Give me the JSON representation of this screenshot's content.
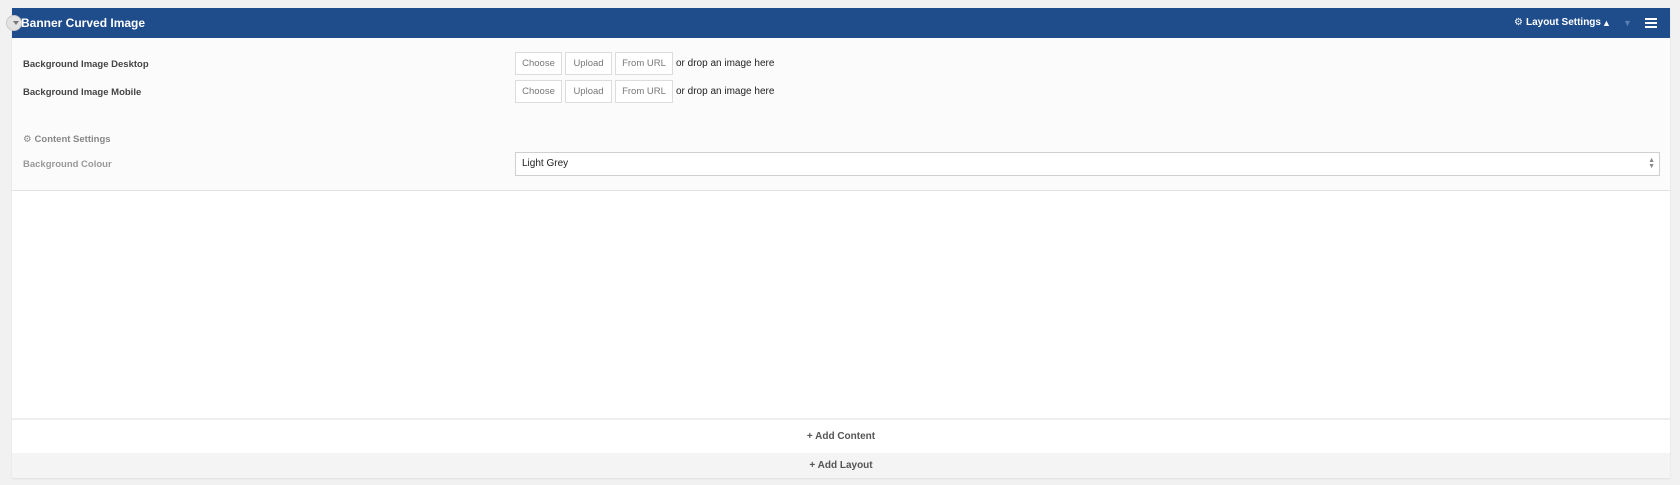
{
  "header": {
    "title": "Banner Curved Image",
    "layout_settings_label": "Layout Settings",
    "move_up_glyph": "▲",
    "move_down_glyph": "▼",
    "icons": [
      "collapse-toggle-icon",
      "gear-icon",
      "menu-icon"
    ],
    "bg_color": "#1f4d8c"
  },
  "fields": {
    "bg_desktop": {
      "label": "Background Image Desktop",
      "choose": "Choose",
      "upload": "Upload",
      "from_url": "From URL",
      "drop_hint": "or drop an image here"
    },
    "bg_mobile": {
      "label": "Background Image Mobile",
      "choose": "Choose",
      "upload": "Upload",
      "from_url": "From URL",
      "drop_hint": "or drop an image here"
    }
  },
  "content_settings": {
    "heading": "Content Settings",
    "bg_colour_label": "Background Colour",
    "bg_colour_value": "Light Grey"
  },
  "footer": {
    "add_content": "+ Add Content",
    "add_layout": "+ Add Layout"
  }
}
